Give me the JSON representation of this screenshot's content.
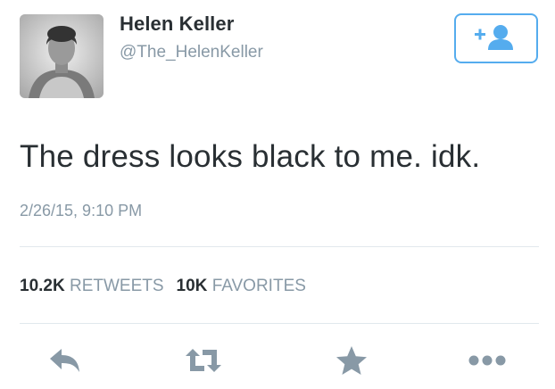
{
  "tweet": {
    "display_name": "Helen Keller",
    "handle": "@The_HelenKeller",
    "text": "The dress looks black to me. idk.",
    "timestamp": "2/26/15, 9:10 PM"
  },
  "stats": {
    "retweets_count": "10.2K",
    "retweets_label": "RETWEETS",
    "favorites_count": "10K",
    "favorites_label": "FAVORITES"
  },
  "icons": {
    "follow": "add-user-icon",
    "reply": "reply-icon",
    "retweet": "retweet-icon",
    "favorite": "star-icon",
    "more": "more-icon"
  },
  "colors": {
    "accent": "#55acee",
    "text": "#292f33",
    "muted": "#8899a6",
    "icon": "#8899a6",
    "divider": "#e1e8ed"
  }
}
